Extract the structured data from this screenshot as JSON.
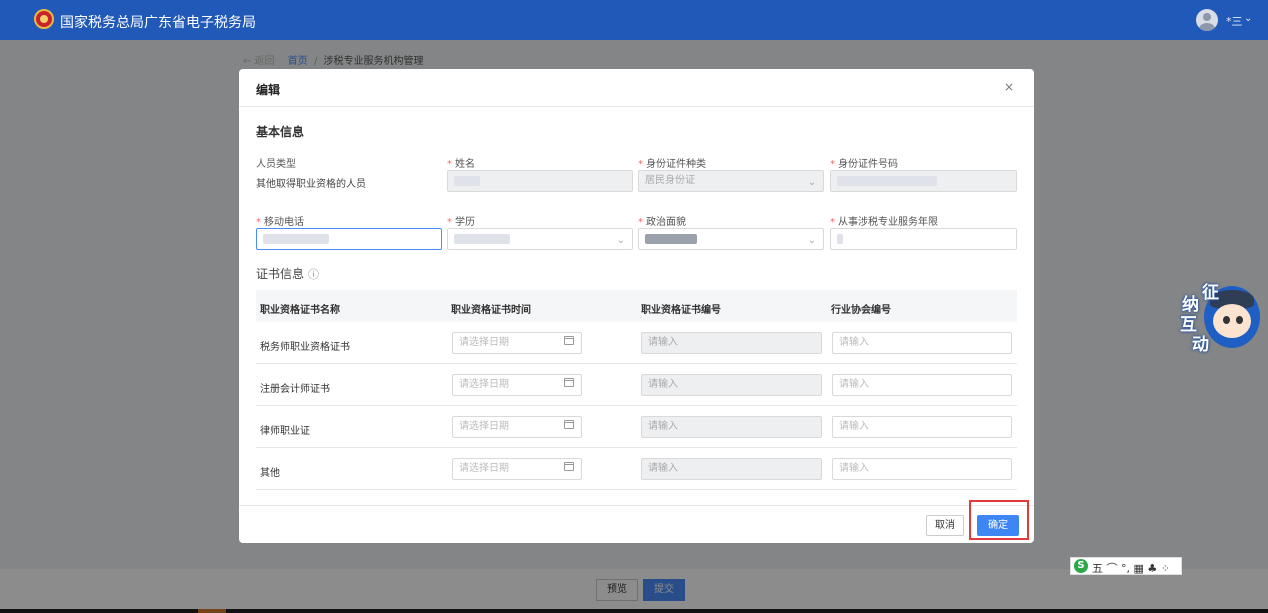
{
  "header": {
    "site_title": "国家税务总局广东省电子税务局",
    "user_name": "*三",
    "caret": "⌄"
  },
  "breadcrumb": {
    "back": "← 返回",
    "home": "首页",
    "sep": "/",
    "current": "涉税专业服务机构管理"
  },
  "footer": {
    "preview": "预览",
    "submit": "提交"
  },
  "modal": {
    "title": "编辑",
    "close": "×",
    "basic_title": "基本信息",
    "fields": {
      "person_type_label": "人员类型",
      "person_type_value": "其他取得职业资格的人员",
      "name_label": "姓名",
      "id_type_label": "身份证件种类",
      "id_type_value": "居民身份证",
      "id_number_label": "身份证件号码",
      "mobile_label": "移动电话",
      "education_label": "学历",
      "political_label": "政治面貌",
      "years_label": "从事涉税专业服务年限",
      "required_mark": "*"
    },
    "cert_title": "证书信息",
    "cert_info_icon": "ⓘ",
    "cert_table": {
      "headers": [
        "职业资格证书名称",
        "职业资格证书时间",
        "职业资格证书编号",
        "行业协会编号"
      ],
      "date_placeholder": "请选择日期",
      "input_placeholder": "请输入",
      "rows": [
        {
          "name": "税务师职业资格证书"
        },
        {
          "name": "注册会计师证书"
        },
        {
          "name": "律师职业证"
        },
        {
          "name": "其他"
        }
      ]
    },
    "cancel": "取消",
    "ok": "确定"
  },
  "mascot": {
    "chars": [
      "征",
      "纳",
      "互",
      "动"
    ]
  },
  "ime": {
    "logo": "S",
    "text": "五 ⌒ °, ▦ ♣ ⁘"
  },
  "colors": {
    "header_bg": "#2159b8",
    "primary": "#3f86f5",
    "required": "#f56c6c",
    "highlight": "#e23a3a"
  }
}
